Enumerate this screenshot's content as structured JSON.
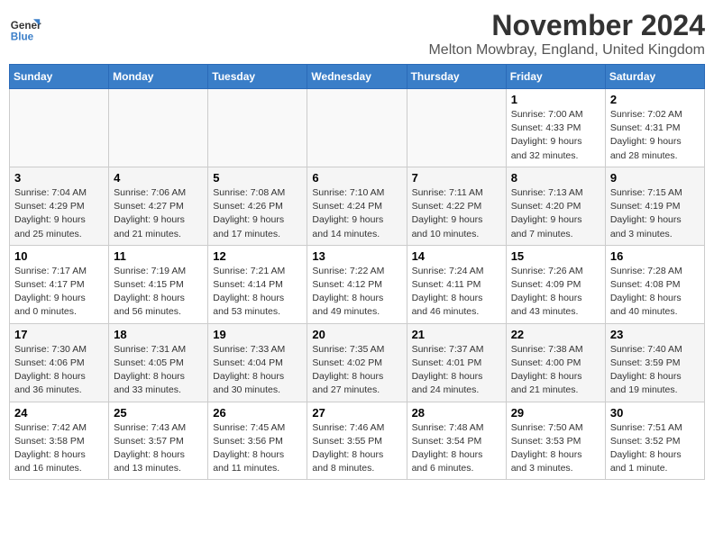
{
  "header": {
    "month_title": "November 2024",
    "location": "Melton Mowbray, England, United Kingdom"
  },
  "logo": {
    "line1": "General",
    "line2": "Blue"
  },
  "days_of_week": [
    "Sunday",
    "Monday",
    "Tuesday",
    "Wednesday",
    "Thursday",
    "Friday",
    "Saturday"
  ],
  "weeks": [
    [
      {
        "day": "",
        "info": ""
      },
      {
        "day": "",
        "info": ""
      },
      {
        "day": "",
        "info": ""
      },
      {
        "day": "",
        "info": ""
      },
      {
        "day": "",
        "info": ""
      },
      {
        "day": "1",
        "info": "Sunrise: 7:00 AM\nSunset: 4:33 PM\nDaylight: 9 hours and 32 minutes."
      },
      {
        "day": "2",
        "info": "Sunrise: 7:02 AM\nSunset: 4:31 PM\nDaylight: 9 hours and 28 minutes."
      }
    ],
    [
      {
        "day": "3",
        "info": "Sunrise: 7:04 AM\nSunset: 4:29 PM\nDaylight: 9 hours and 25 minutes."
      },
      {
        "day": "4",
        "info": "Sunrise: 7:06 AM\nSunset: 4:27 PM\nDaylight: 9 hours and 21 minutes."
      },
      {
        "day": "5",
        "info": "Sunrise: 7:08 AM\nSunset: 4:26 PM\nDaylight: 9 hours and 17 minutes."
      },
      {
        "day": "6",
        "info": "Sunrise: 7:10 AM\nSunset: 4:24 PM\nDaylight: 9 hours and 14 minutes."
      },
      {
        "day": "7",
        "info": "Sunrise: 7:11 AM\nSunset: 4:22 PM\nDaylight: 9 hours and 10 minutes."
      },
      {
        "day": "8",
        "info": "Sunrise: 7:13 AM\nSunset: 4:20 PM\nDaylight: 9 hours and 7 minutes."
      },
      {
        "day": "9",
        "info": "Sunrise: 7:15 AM\nSunset: 4:19 PM\nDaylight: 9 hours and 3 minutes."
      }
    ],
    [
      {
        "day": "10",
        "info": "Sunrise: 7:17 AM\nSunset: 4:17 PM\nDaylight: 9 hours and 0 minutes."
      },
      {
        "day": "11",
        "info": "Sunrise: 7:19 AM\nSunset: 4:15 PM\nDaylight: 8 hours and 56 minutes."
      },
      {
        "day": "12",
        "info": "Sunrise: 7:21 AM\nSunset: 4:14 PM\nDaylight: 8 hours and 53 minutes."
      },
      {
        "day": "13",
        "info": "Sunrise: 7:22 AM\nSunset: 4:12 PM\nDaylight: 8 hours and 49 minutes."
      },
      {
        "day": "14",
        "info": "Sunrise: 7:24 AM\nSunset: 4:11 PM\nDaylight: 8 hours and 46 minutes."
      },
      {
        "day": "15",
        "info": "Sunrise: 7:26 AM\nSunset: 4:09 PM\nDaylight: 8 hours and 43 minutes."
      },
      {
        "day": "16",
        "info": "Sunrise: 7:28 AM\nSunset: 4:08 PM\nDaylight: 8 hours and 40 minutes."
      }
    ],
    [
      {
        "day": "17",
        "info": "Sunrise: 7:30 AM\nSunset: 4:06 PM\nDaylight: 8 hours and 36 minutes."
      },
      {
        "day": "18",
        "info": "Sunrise: 7:31 AM\nSunset: 4:05 PM\nDaylight: 8 hours and 33 minutes."
      },
      {
        "day": "19",
        "info": "Sunrise: 7:33 AM\nSunset: 4:04 PM\nDaylight: 8 hours and 30 minutes."
      },
      {
        "day": "20",
        "info": "Sunrise: 7:35 AM\nSunset: 4:02 PM\nDaylight: 8 hours and 27 minutes."
      },
      {
        "day": "21",
        "info": "Sunrise: 7:37 AM\nSunset: 4:01 PM\nDaylight: 8 hours and 24 minutes."
      },
      {
        "day": "22",
        "info": "Sunrise: 7:38 AM\nSunset: 4:00 PM\nDaylight: 8 hours and 21 minutes."
      },
      {
        "day": "23",
        "info": "Sunrise: 7:40 AM\nSunset: 3:59 PM\nDaylight: 8 hours and 19 minutes."
      }
    ],
    [
      {
        "day": "24",
        "info": "Sunrise: 7:42 AM\nSunset: 3:58 PM\nDaylight: 8 hours and 16 minutes."
      },
      {
        "day": "25",
        "info": "Sunrise: 7:43 AM\nSunset: 3:57 PM\nDaylight: 8 hours and 13 minutes."
      },
      {
        "day": "26",
        "info": "Sunrise: 7:45 AM\nSunset: 3:56 PM\nDaylight: 8 hours and 11 minutes."
      },
      {
        "day": "27",
        "info": "Sunrise: 7:46 AM\nSunset: 3:55 PM\nDaylight: 8 hours and 8 minutes."
      },
      {
        "day": "28",
        "info": "Sunrise: 7:48 AM\nSunset: 3:54 PM\nDaylight: 8 hours and 6 minutes."
      },
      {
        "day": "29",
        "info": "Sunrise: 7:50 AM\nSunset: 3:53 PM\nDaylight: 8 hours and 3 minutes."
      },
      {
        "day": "30",
        "info": "Sunrise: 7:51 AM\nSunset: 3:52 PM\nDaylight: 8 hours and 1 minute."
      }
    ]
  ]
}
